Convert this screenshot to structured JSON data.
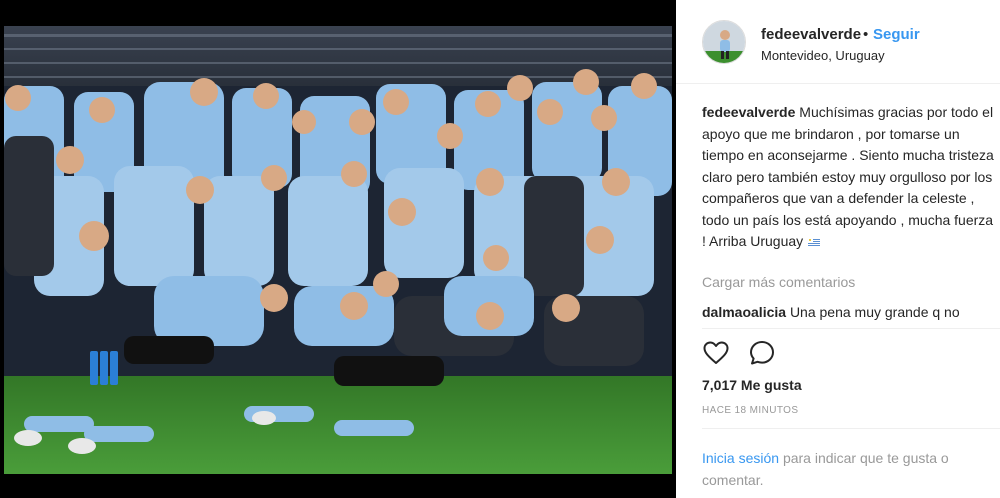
{
  "post": {
    "username": "fedeevalverde",
    "separator": "•",
    "follow_label": "Seguir",
    "location": "Montevideo, Uruguay"
  },
  "caption": {
    "username": "fedeevalverde",
    "text": "Muchísimas gracias por todo el apoyo que me brindaron , por tomarse un tiempo en aconsejarme . Siento mucha tristeza claro pero también estoy muy orgulloso por los compañeros que van a defender la celeste , todo un país los está apoyando , mucha fuerza ! Arriba Uruguay"
  },
  "comments": {
    "load_more_label": "Cargar más comentarios",
    "items": [
      {
        "username": "dalmaoalicia",
        "text": "Una pena muy grande q no"
      }
    ]
  },
  "engagement": {
    "likes_label": "7,017 Me gusta",
    "time_label": "HACE 18 MINUTOS"
  },
  "footer": {
    "login_link": "Inicia sesión",
    "login_text": "para indicar que te gusta o comentar."
  },
  "colors": {
    "accent": "#3897f0",
    "jersey_celeste": "#8fbde6",
    "grass": "#3c8f2e"
  },
  "icons": {
    "like": "heart-icon",
    "comment": "speech-bubble-icon",
    "flag": "uruguay-flag-icon"
  }
}
